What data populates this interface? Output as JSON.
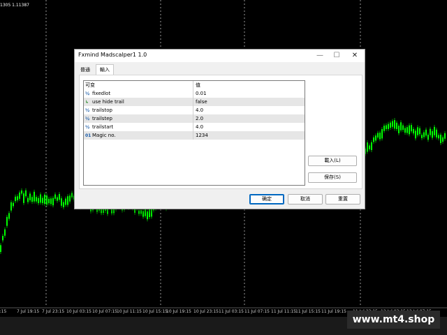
{
  "background": {
    "price_label": "1305 1.11387",
    "time_labels": [
      "15:15",
      "7 Jul 19:15",
      "7 Jul 23:15",
      "10 Jul 03:15",
      "10 Jul 07:15",
      "10 Jul 11:15",
      "10 Jul 15:15",
      "10 Jul 19:15",
      "10 Jul 23:15",
      "11 Jul 03:15",
      "11 Jul 07:15",
      "11 Jul 11:15",
      "11 Jul 15:15",
      "11 Jul 19:15",
      "11 Jul 23:15",
      "12 Jul 03:15",
      "12 Jul 07:15"
    ],
    "watermark": "www.mt4.shop",
    "colors": {
      "candles": "#00ff00",
      "background": "#000000",
      "grid": "#ffffff"
    }
  },
  "dialog": {
    "title": "Fxmind Madscalper1 1.0",
    "tabs": [
      {
        "label": "普通",
        "active": false
      },
      {
        "label": "輸入",
        "active": true
      }
    ],
    "table": {
      "headers": [
        "可变",
        "值"
      ],
      "rows": [
        {
          "icon": "½",
          "icon_name": "double-type-icon",
          "name": "fixedlot",
          "value": "0.01"
        },
        {
          "icon": "↳",
          "icon_name": "bool-type-icon",
          "name": "use hide trail",
          "value": "false"
        },
        {
          "icon": "½",
          "icon_name": "double-type-icon",
          "name": "trailstop",
          "value": "4.0"
        },
        {
          "icon": "½",
          "icon_name": "double-type-icon",
          "name": "trailstep",
          "value": "2.0"
        },
        {
          "icon": "½",
          "icon_name": "double-type-icon",
          "name": "trailstart",
          "value": "4.0"
        },
        {
          "icon": "01",
          "icon_name": "int-type-icon",
          "name": "Magic no.",
          "value": "1234"
        }
      ]
    },
    "side_buttons": {
      "load": "載入(L)",
      "save": "保存(S)"
    },
    "footer_buttons": {
      "ok": "确定",
      "cancel": "取消",
      "reset": "重置"
    },
    "window_controls": {
      "minimize": "—",
      "maximize": "☐",
      "close": "✕"
    }
  }
}
